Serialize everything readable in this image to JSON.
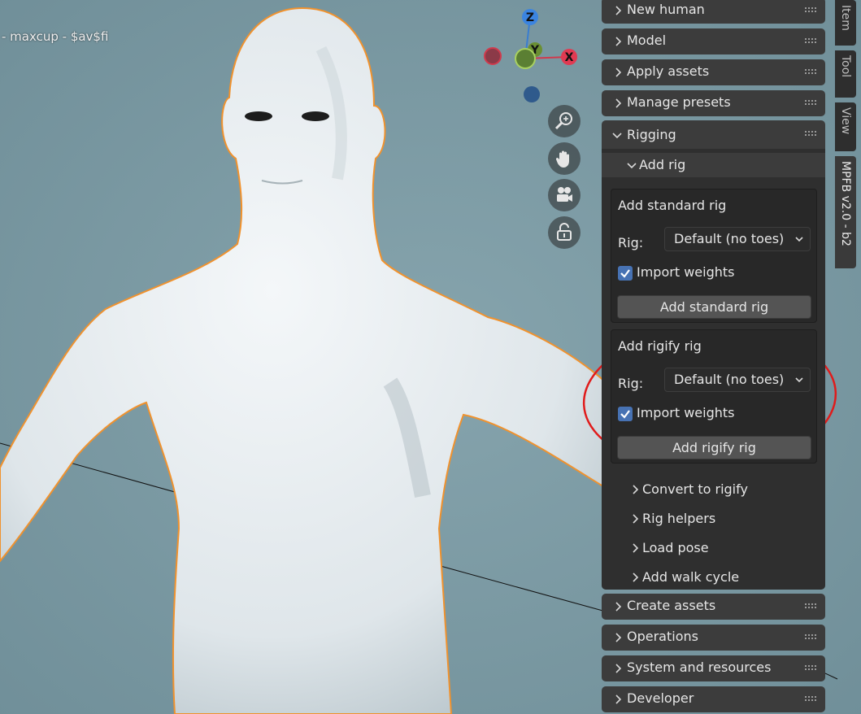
{
  "viewport": {
    "overlay_text": "- maxcup - $av$fi",
    "gizmo": {
      "z": "Z",
      "y": "Y",
      "x": "X"
    },
    "nav_buttons": [
      "zoom-icon",
      "pan-hand-icon",
      "camera-icon",
      "lock-icon"
    ]
  },
  "panel": {
    "sections_top": [
      {
        "label": "New human",
        "icon": "chevron-right-icon"
      },
      {
        "label": "Model",
        "icon": "chevron-right-icon"
      },
      {
        "label": "Apply assets",
        "icon": "chevron-right-icon"
      },
      {
        "label": "Manage presets",
        "icon": "chevron-right-icon"
      }
    ],
    "rigging": {
      "label": "Rigging",
      "icon": "chevron-down-icon",
      "add_rig": {
        "label": "Add rig",
        "standard": {
          "title": "Add standard rig",
          "rig_label": "Rig:",
          "rig_value": "Default (no toes)",
          "import_weights_label": "Import weights",
          "import_weights_checked": true,
          "button": "Add standard rig"
        },
        "rigify": {
          "title": "Add rigify rig",
          "rig_label": "Rig:",
          "rig_value": "Default (no toes)",
          "import_weights_label": "Import weights",
          "import_weights_checked": true,
          "button": "Add rigify rig"
        }
      },
      "subsections": [
        {
          "label": "Convert to rigify"
        },
        {
          "label": "Rig helpers"
        },
        {
          "label": "Load pose"
        },
        {
          "label": "Add walk cycle"
        }
      ]
    },
    "sections_bottom": [
      {
        "label": "Create assets"
      },
      {
        "label": "Operations"
      },
      {
        "label": "System and resources"
      },
      {
        "label": "Developer"
      }
    ]
  },
  "tabs": [
    {
      "label": "Item",
      "active": false
    },
    {
      "label": "Tool",
      "active": false
    },
    {
      "label": "View",
      "active": false
    },
    {
      "label": "MPFB v2.0 - b2",
      "active": true
    }
  ],
  "colors": {
    "viewport_bg": "#7a99a3",
    "selection_outline": "#f0922e",
    "annotation_circle": "#e01b1b",
    "checkbox": "#4772b3"
  }
}
